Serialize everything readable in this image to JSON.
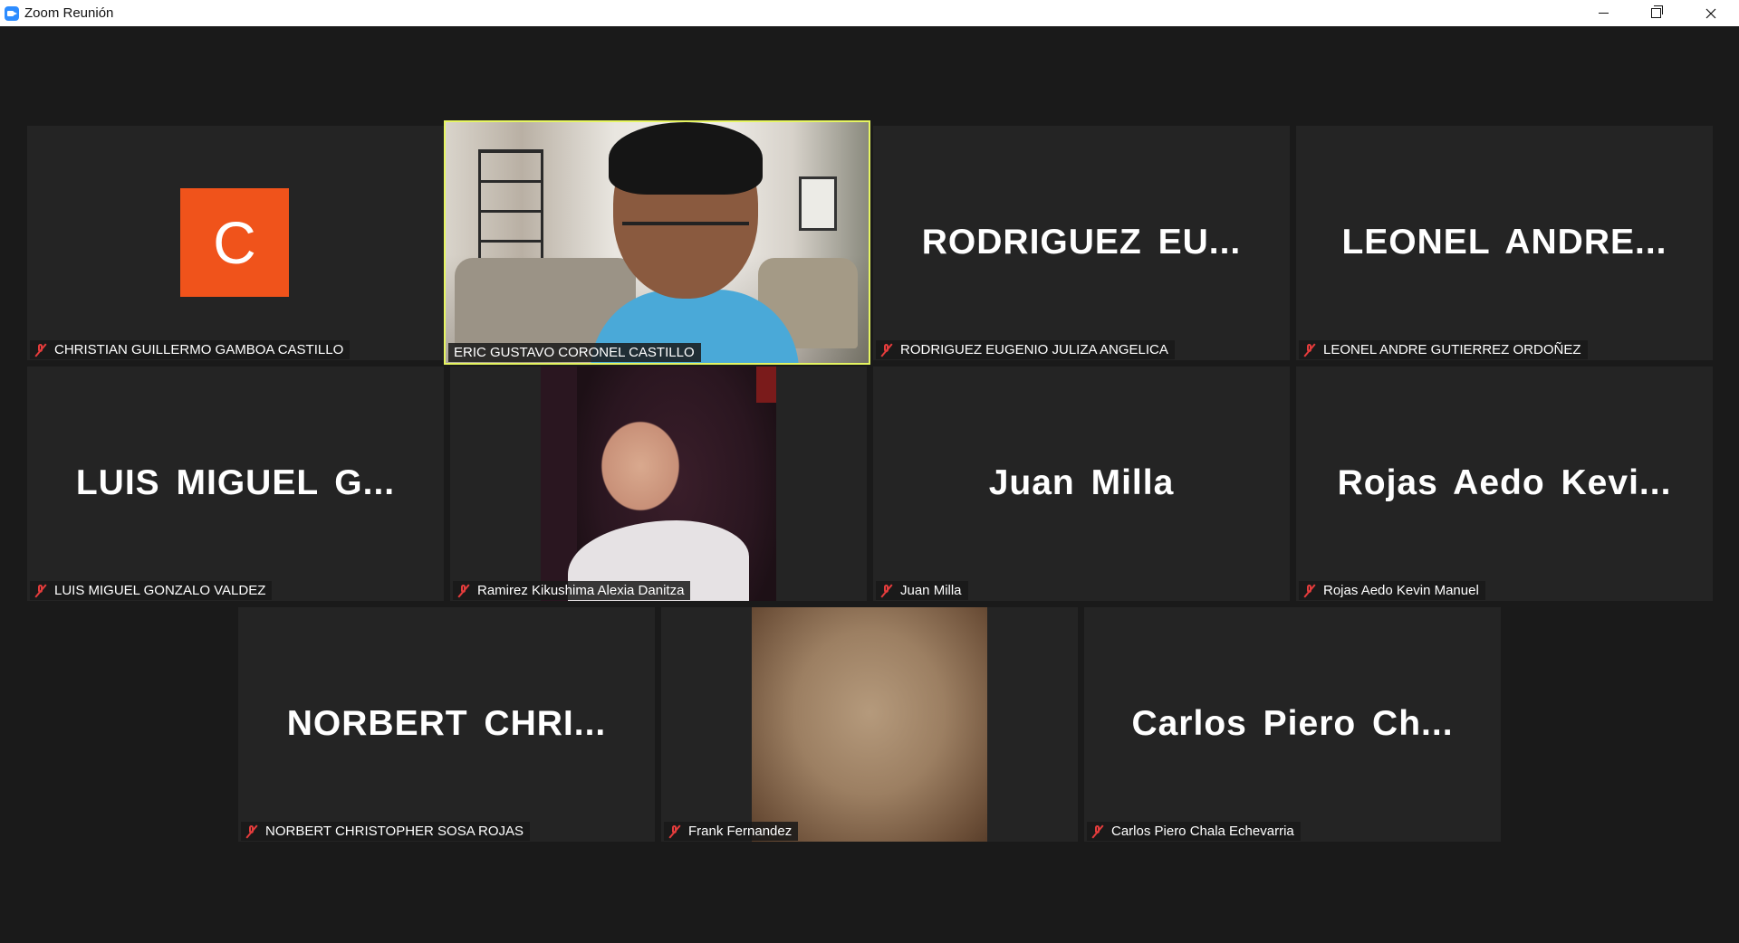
{
  "window": {
    "title": "Zoom Reunión",
    "app_icon": "zoom-camera-icon",
    "controls": [
      "minimize",
      "maximize",
      "close"
    ]
  },
  "colors": {
    "background": "#1a1a1a",
    "tile": "#242424",
    "active_speaker_outline": "#e6f561",
    "avatar_orange": "#f0531b",
    "muted_red": "#e53c3c"
  },
  "participants": [
    {
      "display_name": "CHRISTIAN GUILLERMO GAMBOA CASTILLO",
      "tile_label": "",
      "avatar_letter": "C",
      "muted": true,
      "video": false
    },
    {
      "display_name": "ERIC GUSTAVO CORONEL CASTILLO",
      "tile_label": "",
      "muted": false,
      "video": true,
      "active_speaker": true
    },
    {
      "display_name": "RODRIGUEZ EUGENIO JULIZA ANGELICA",
      "tile_label": "RODRIGUEZ  EU...",
      "muted": true,
      "video": false
    },
    {
      "display_name": "LEONEL ANDRE GUTIERREZ ORDOÑEZ",
      "tile_label": "LEONEL  ANDRE...",
      "muted": true,
      "video": false
    },
    {
      "display_name": "LUIS MIGUEL GONZALO VALDEZ",
      "tile_label": "LUIS  MIGUEL  G...",
      "muted": true,
      "video": false
    },
    {
      "display_name": "Ramirez Kikushima Alexia Danitza",
      "tile_label": "",
      "muted": true,
      "video": true
    },
    {
      "display_name": "Juan Milla",
      "tile_label": "Juan Milla",
      "muted": true,
      "video": false
    },
    {
      "display_name": "Rojas Aedo Kevin Manuel",
      "tile_label": "Rojas  Aedo  Kevi...",
      "muted": true,
      "video": false
    },
    {
      "display_name": "NORBERT CHRISTOPHER SOSA ROJAS",
      "tile_label": "NORBERT  CHRI...",
      "muted": true,
      "video": false
    },
    {
      "display_name": "Frank Fernandez",
      "tile_label": "",
      "muted": true,
      "video": true
    },
    {
      "display_name": "Carlos Piero Chala Echevarria",
      "tile_label": "Carlos  Piero  Ch...",
      "muted": true,
      "video": false
    }
  ]
}
